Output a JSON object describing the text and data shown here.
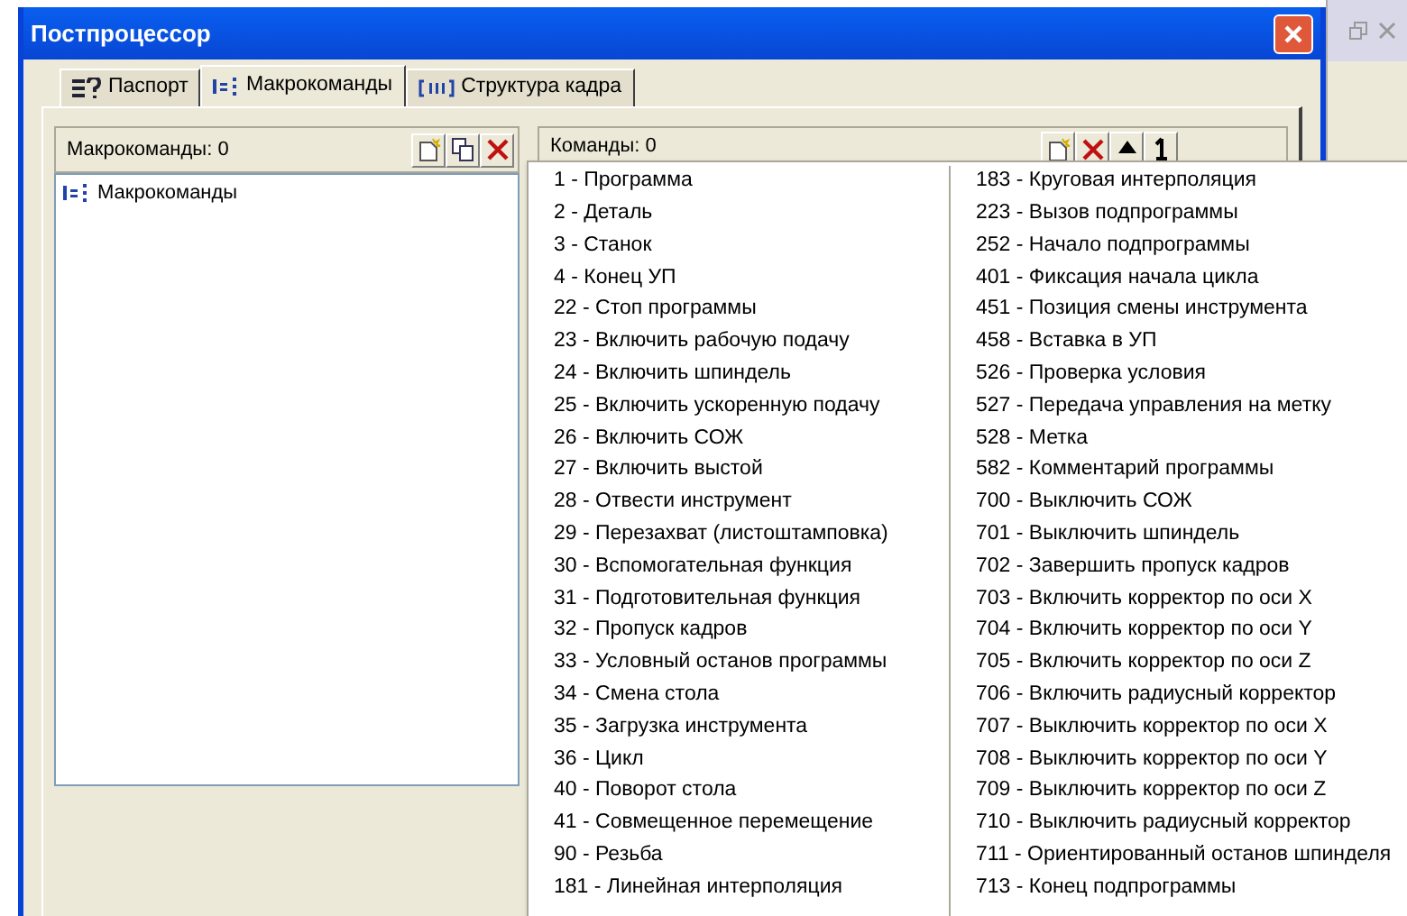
{
  "window": {
    "title": "Постпроцессор"
  },
  "tabs": [
    {
      "label": "Паспорт",
      "selected": false,
      "kind": "question"
    },
    {
      "label": "Макрокоманды",
      "selected": true,
      "kind": "macro"
    },
    {
      "label": "Структура кадра",
      "selected": false,
      "kind": "frame"
    }
  ],
  "left_pane": {
    "header": "Макрокоманды: 0",
    "tree": [
      {
        "label": "Макрокоманды"
      }
    ]
  },
  "right_pane": {
    "header": "Команды: 0"
  },
  "menu": {
    "columns": [
      [
        "1 - Программа",
        "2 - Деталь",
        "3 - Станок",
        "4 - Конец УП",
        "22 - Стоп программы",
        "23 - Включить рабочую подачу",
        "24 - Включить шпиндель",
        "25 - Включить ускоренную подачу",
        "26 - Включить СОЖ",
        "27 - Включить выстой",
        "28 - Отвести инструмент",
        "29 - Перезахват (листоштамповка)",
        "30 - Вспомогательная функция",
        "31 - Подготовительная функция",
        "32 - Пропуск кадров",
        "33 - Условный останов программы",
        "34 - Смена стола",
        "35 - Загрузка инструмента",
        "36 - Цикл",
        "40 - Поворот стола",
        "41 - Совмещенное перемещение",
        "90 - Резьба",
        "181 - Линейная интерполяция"
      ],
      [
        "183 - Круговая интерполяция",
        "223 - Вызов подпрограммы",
        "252 - Начало подпрограммы",
        "401 - Фиксация начала цикла",
        "451 - Позиция смены инструмента",
        "458 - Вставка в УП",
        "526 - Проверка условия",
        "527 - Передача управления на метку",
        "528 - Метка",
        "582 - Комментарий программы",
        "700 - Выключить СОЖ",
        "701 - Выключить шпиндель",
        "702 - Завершить пропуск кадров",
        "703 - Включить корректор по оси X",
        "704 - Включить корректор по оси Y",
        "705 - Включить корректор по оси Z",
        "706 - Включить радиусный корректор",
        "707 - Выключить корректор по оси X",
        "708 - Выключить корректор по оси Y",
        "709 - Выключить корректор по оси Z",
        "710 - Выключить радиусный корректор",
        "711 - Ориентированный останов шпинделя",
        "713 - Конец подпрограммы"
      ]
    ]
  }
}
